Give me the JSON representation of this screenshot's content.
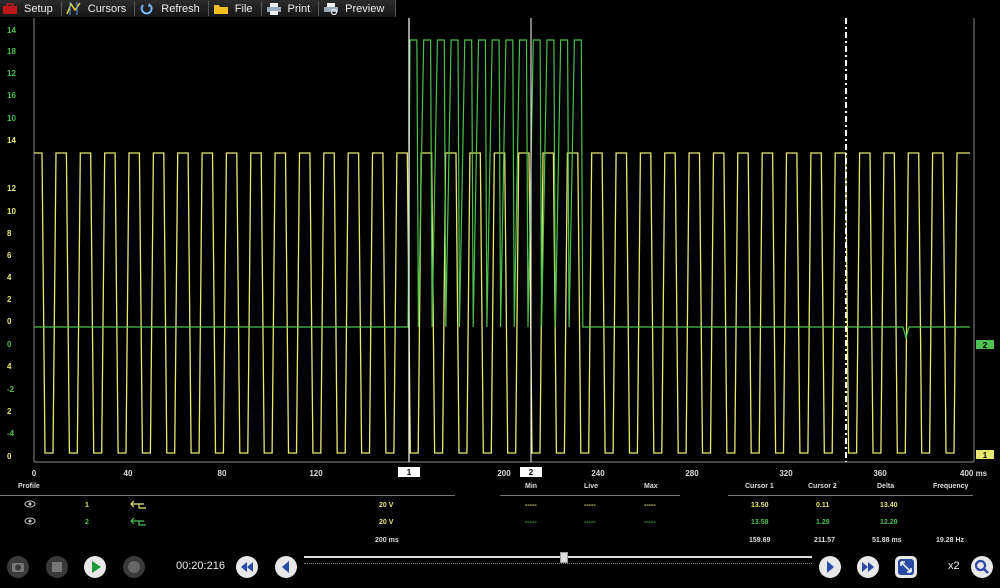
{
  "toolbar": {
    "setup": "Setup",
    "cursors": "Cursors",
    "refresh": "Refresh",
    "file": "File",
    "print": "Print",
    "preview": "Preview"
  },
  "colors": {
    "ch1": "#e8e870",
    "ch2": "#4ec04e",
    "cursor": "#ffffff"
  },
  "axes": {
    "green_ticks": [
      "14",
      "18",
      "12",
      "16",
      "10",
      "14"
    ],
    "yellow_ticks": [
      "12",
      "10",
      "8",
      "6",
      "4",
      "2",
      "0"
    ],
    "mixed_ticks": [
      {
        "t": "0",
        "c": "green"
      },
      {
        "t": "4",
        "c": "yellow"
      },
      {
        "t": "-2",
        "c": "green"
      },
      {
        "t": "2",
        "c": "yellow"
      },
      {
        "t": "-4",
        "c": "green"
      },
      {
        "t": "0",
        "c": "yellow"
      }
    ],
    "x_ticks": [
      "0",
      "40",
      "80",
      "120",
      "160",
      "200",
      "240",
      "280",
      "320",
      "360",
      "400 ms"
    ],
    "cursor1_label": "1",
    "cursor2_label": "2",
    "ch2_marker": "2",
    "ch1_marker": "1"
  },
  "table": {
    "profile_header": "Profile",
    "min_header": "Min",
    "live_header": "Live",
    "max_header": "Max",
    "cursor1_header": "Cursor 1",
    "cursor2_header": "Cursor 2",
    "delta_header": "Delta",
    "frequency_header": "Frequency",
    "rows": [
      {
        "num": "1",
        "scale": "20 V",
        "min": "-----",
        "live": "-----",
        "max": "-----",
        "c1": "13.50",
        "c2": "0.11",
        "delta": "13.40"
      },
      {
        "num": "2",
        "scale": "20 V",
        "min": "-----",
        "live": "-----",
        "max": "-----",
        "c1": "13.58",
        "c2": "1.29",
        "delta": "12.29"
      }
    ],
    "timebase": "200 ms",
    "time_c1": "159.69",
    "time_c2": "211.57",
    "time_delta": "51.88 ms",
    "frequency": "19.28 Hz"
  },
  "bottom": {
    "time": "00:20:216",
    "zoom": "x2",
    "slider_position": 0.51
  }
}
